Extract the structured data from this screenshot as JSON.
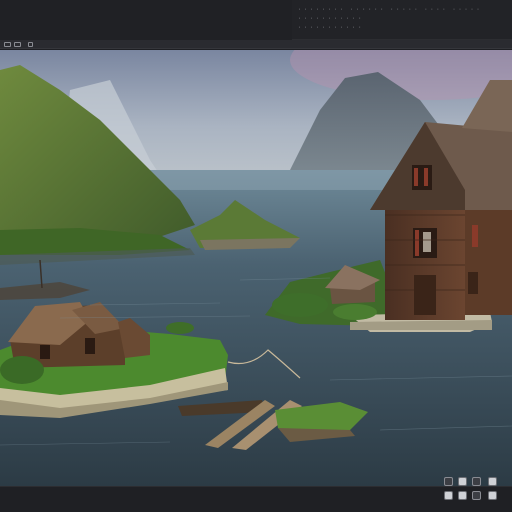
{
  "app": {
    "readout_lines": [
      [
        "· · · · · · · ·",
        "· · · · · ·",
        "· · · · ·",
        "· · · ·",
        "· · · · ·"
      ],
      [
        "· · · · · · · · · · ·"
      ],
      [
        "· · · · · · · · · · ·"
      ]
    ]
  },
  "colors": {
    "chrome": "#222327",
    "chrome_dark": "#1e1f23",
    "water": "#3c5260",
    "sky_top": "#6f7d98",
    "sky_bottom": "#a9b6c4",
    "wood": "#5a3a26",
    "roof": "#6b5648",
    "grass": "#4c7a2e"
  },
  "icons": [
    "view-mode-icon",
    "frame-icon",
    "layers-icon",
    "settings-icon",
    "camera-icon",
    "render-icon"
  ]
}
